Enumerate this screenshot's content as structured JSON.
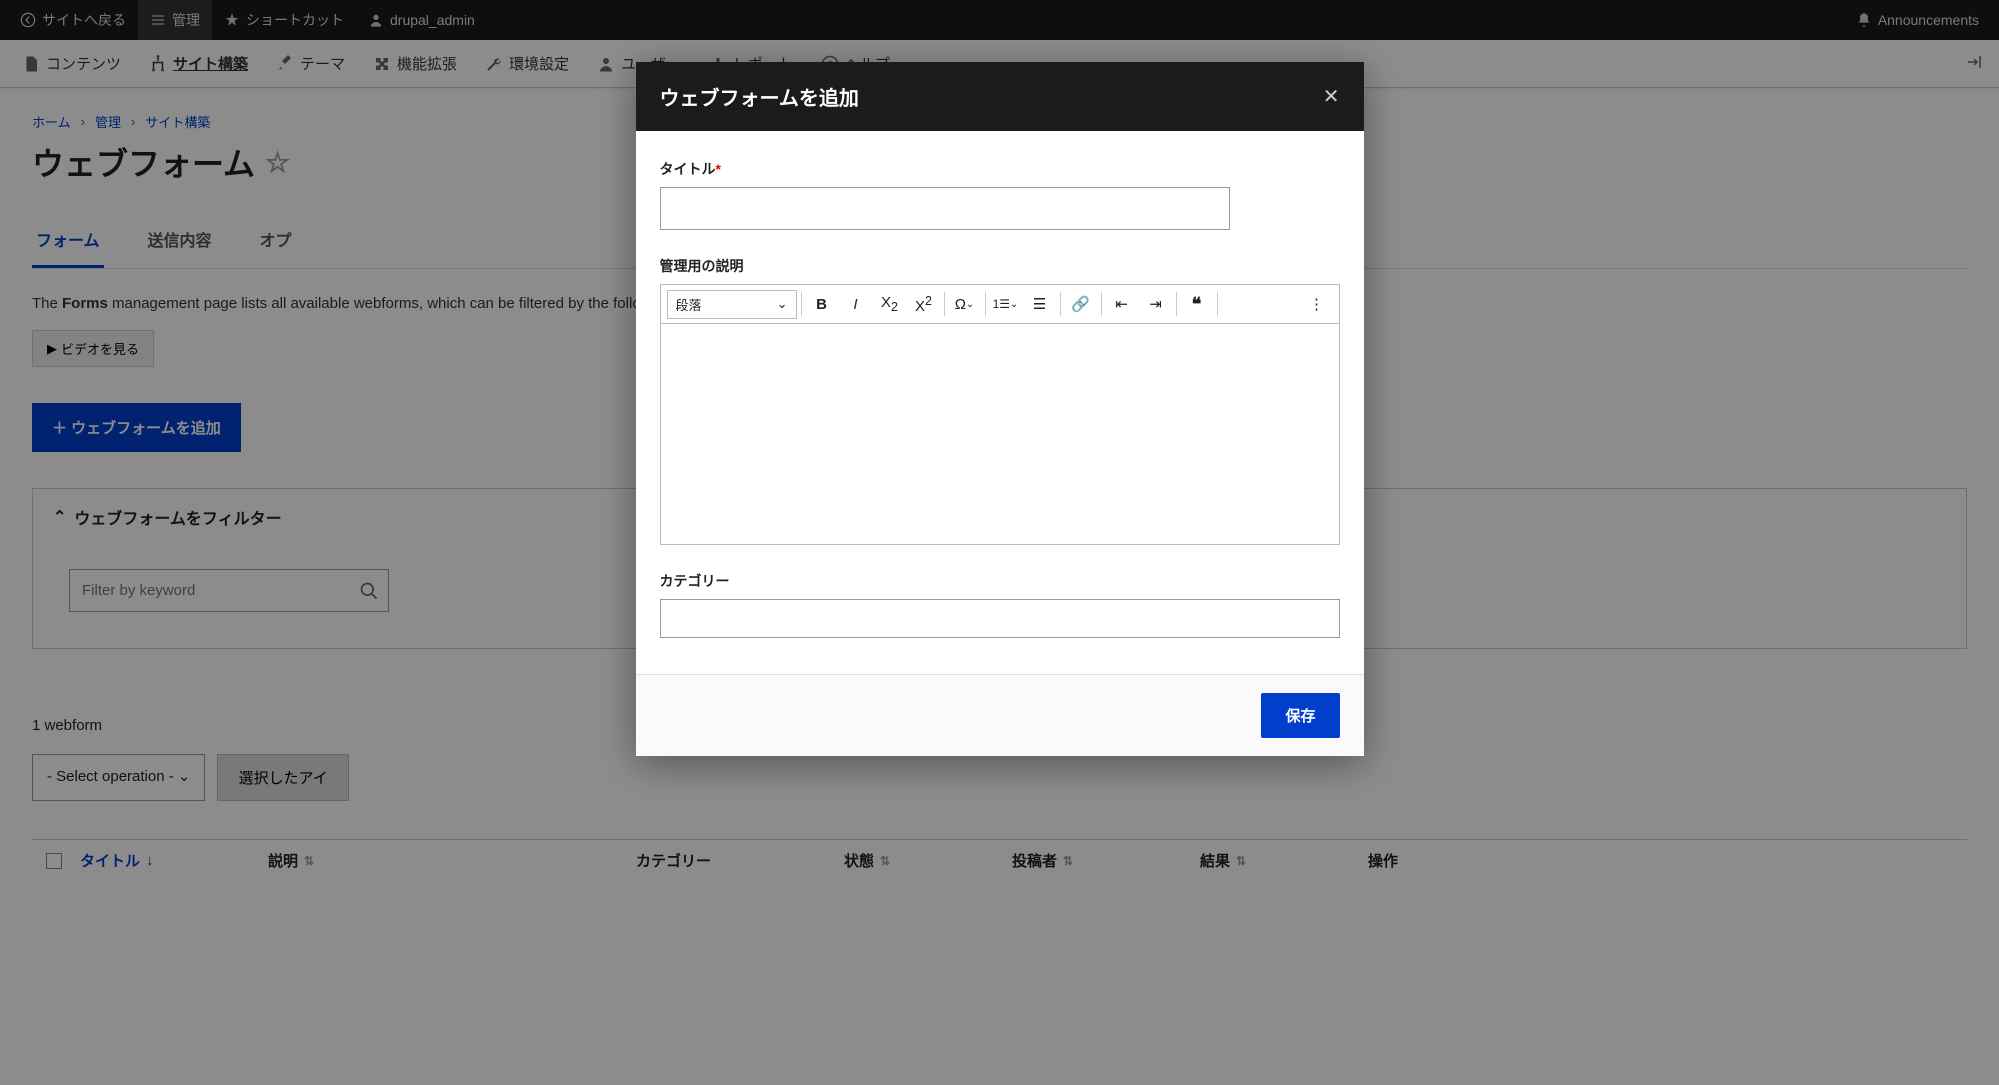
{
  "topbar": {
    "back": "サイトへ戻る",
    "manage": "管理",
    "shortcuts": "ショートカット",
    "user": "drupal_admin",
    "announcements": "Announcements"
  },
  "secondbar": {
    "content": "コンテンツ",
    "structure": "サイト構築",
    "appearance": "テーマ",
    "extend": "機能拡張",
    "config": "環境設定",
    "people": "ユーザー",
    "reports": "レポート",
    "help": "ヘルプ"
  },
  "breadcrumb": {
    "home": "ホーム",
    "admin": "管理",
    "structure": "サイト構築"
  },
  "page": {
    "title": "ウェブフォーム",
    "tabs": {
      "forms": "フォーム",
      "submissions": "送信内容",
      "options": "オプ"
    },
    "desc_pre": "The ",
    "desc_bold": "Forms",
    "desc_post": " management page lists all available webforms, which can be filtered by the following: title, description, elements, user name, or role), category, and status.",
    "video": "ビデオを見る",
    "add": "＋ ウェブフォームを追加",
    "filter_title": "ウェブフォームをフィルター",
    "filter_placeholder": "Filter by keyword",
    "count": "1 webform",
    "select_op": "- Select operation - ",
    "apply": "選択したアイ"
  },
  "table": {
    "title": "タイトル",
    "desc": "説明",
    "category": "カテゴリー",
    "status": "状態",
    "author": "投稿者",
    "results": "結果",
    "ops": "操作"
  },
  "dialog": {
    "title": "ウェブフォームを追加",
    "field_title": "タイトル",
    "field_desc": "管理用の説明",
    "paragraph": "段落",
    "field_category": "カテゴリー",
    "save": "保存"
  }
}
